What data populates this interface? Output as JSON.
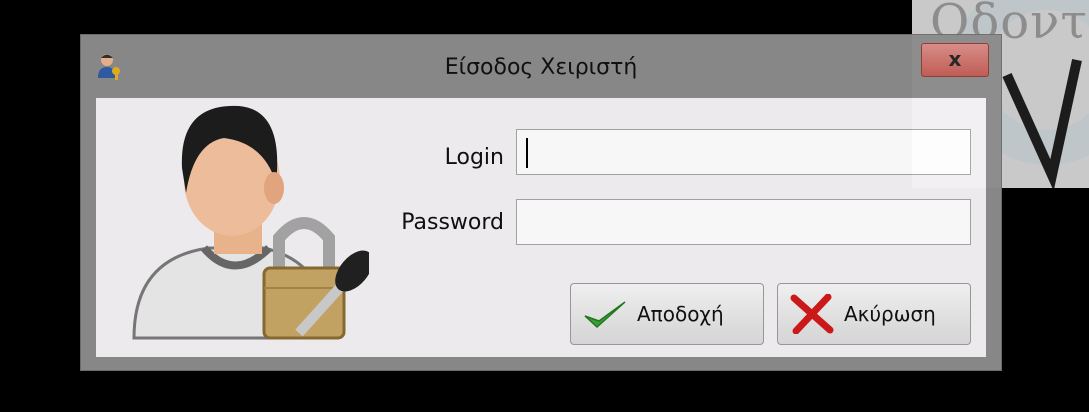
{
  "background": {
    "logo_text": "Οδοντ"
  },
  "window": {
    "title": "Είσοδος Χειριστή",
    "close_label": "x"
  },
  "form": {
    "login_label": "Login",
    "login_value": "",
    "password_label": "Password",
    "password_value": ""
  },
  "buttons": {
    "accept_label": "Αποδοχή",
    "cancel_label": "Ακύρωση"
  },
  "colors": {
    "close_button": "#c05a52",
    "accept_check": "#3aa635",
    "cancel_x": "#d21a1a"
  },
  "icons": {
    "title": "user-key-icon",
    "avatar": "user-lock-avatar-icon",
    "accept": "checkmark-icon",
    "cancel": "red-x-icon"
  }
}
